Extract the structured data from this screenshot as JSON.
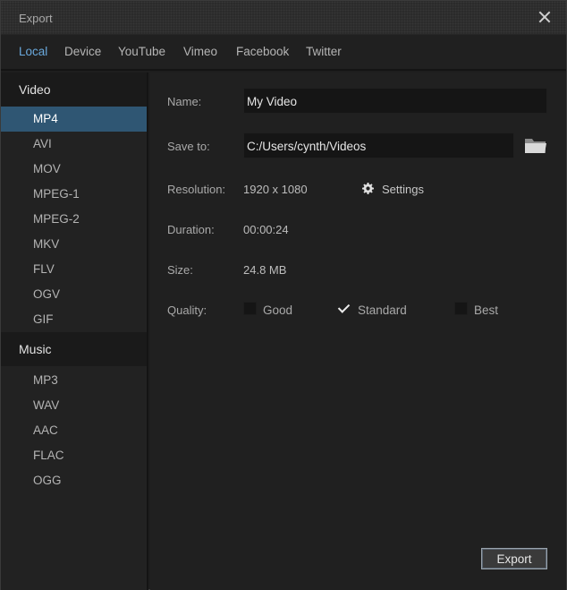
{
  "window": {
    "title": "Export"
  },
  "tabs": [
    {
      "label": "Local",
      "active": true
    },
    {
      "label": "Device",
      "active": false
    },
    {
      "label": "YouTube",
      "active": false
    },
    {
      "label": "Vimeo",
      "active": false
    },
    {
      "label": "Facebook",
      "active": false
    },
    {
      "label": "Twitter",
      "active": false
    }
  ],
  "sidebar": {
    "video_header": "Video",
    "video_formats": [
      "MP4",
      "AVI",
      "MOV",
      "MPEG-1",
      "MPEG-2",
      "MKV",
      "FLV",
      "OGV",
      "GIF"
    ],
    "selected_format": "MP4",
    "music_header": "Music",
    "music_formats": [
      "MP3",
      "WAV",
      "AAC",
      "FLAC",
      "OGG"
    ]
  },
  "form": {
    "name_label": "Name:",
    "name_value": "My Video",
    "save_label": "Save to:",
    "save_value": "C:/Users/cynth/Videos",
    "resolution_label": "Resolution:",
    "resolution_value": "1920 x 1080",
    "settings_label": "Settings",
    "duration_label": "Duration:",
    "duration_value": "00:00:24",
    "size_label": "Size:",
    "size_value": "24.8 MB",
    "quality_label": "Quality:",
    "quality_options": [
      {
        "label": "Good",
        "checked": false
      },
      {
        "label": "Standard",
        "checked": true
      },
      {
        "label": "Best",
        "checked": false
      }
    ]
  },
  "export_button": "Export",
  "icons": {
    "close": "close-icon",
    "folder": "folder-icon",
    "settings": "gear-icon"
  },
  "colors": {
    "accent": "#6aa9dd",
    "selected_bg": "#2f5673"
  }
}
